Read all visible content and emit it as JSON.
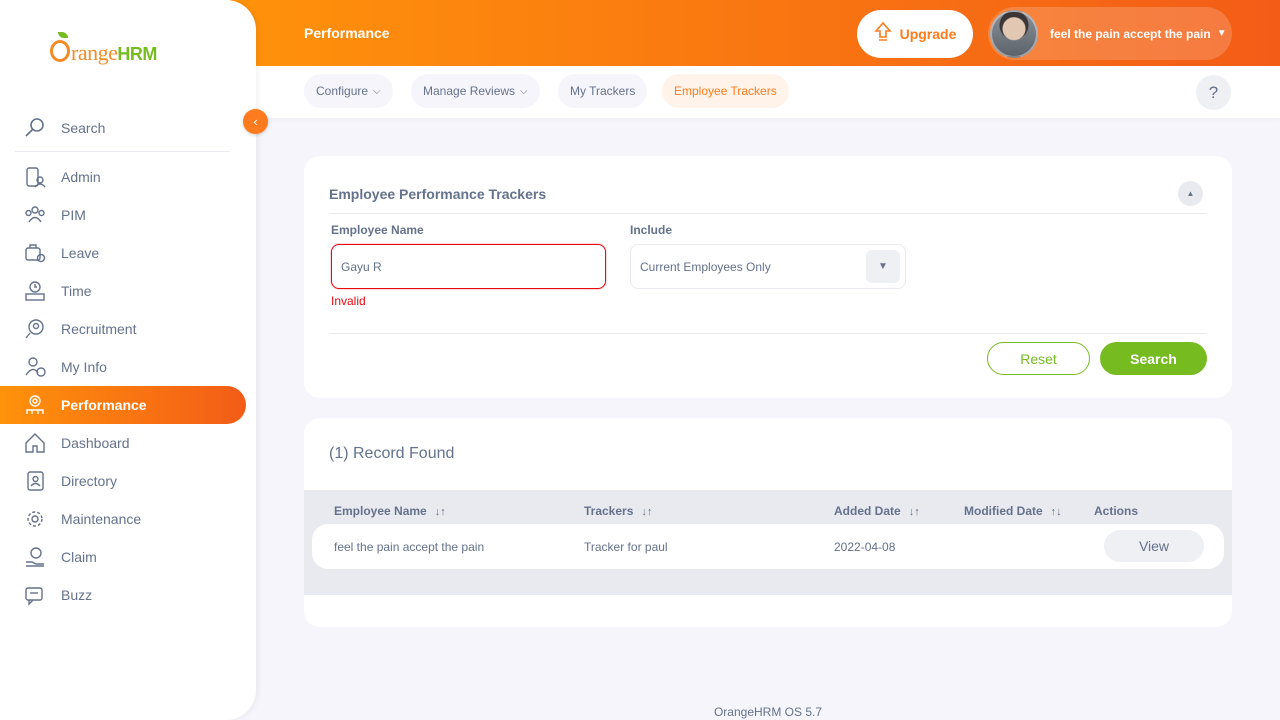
{
  "brand": {
    "name_prefix": "range",
    "name_suffix": "HRM"
  },
  "sidebar": {
    "search_label": "Search",
    "items": [
      {
        "label": "Admin",
        "icon": "admin-icon"
      },
      {
        "label": "PIM",
        "icon": "pim-icon"
      },
      {
        "label": "Leave",
        "icon": "leave-icon"
      },
      {
        "label": "Time",
        "icon": "time-icon"
      },
      {
        "label": "Recruitment",
        "icon": "recruitment-icon"
      },
      {
        "label": "My Info",
        "icon": "my-info-icon"
      },
      {
        "label": "Performance",
        "icon": "performance-icon",
        "active": true
      },
      {
        "label": "Dashboard",
        "icon": "dashboard-icon"
      },
      {
        "label": "Directory",
        "icon": "directory-icon"
      },
      {
        "label": "Maintenance",
        "icon": "maintenance-icon"
      },
      {
        "label": "Claim",
        "icon": "claim-icon"
      },
      {
        "label": "Buzz",
        "icon": "buzz-icon"
      }
    ]
  },
  "header": {
    "title": "Performance",
    "upgrade_label": "Upgrade",
    "user_name": "feel the pain accept the pain"
  },
  "tabs": [
    {
      "label": "Configure",
      "has_dropdown": true
    },
    {
      "label": "Manage Reviews",
      "has_dropdown": true
    },
    {
      "label": "My Trackers",
      "has_dropdown": false
    },
    {
      "label": "Employee Trackers",
      "has_dropdown": false,
      "active": true
    }
  ],
  "help_label": "?",
  "filter": {
    "title": "Employee Performance Trackers",
    "employee_name_label": "Employee Name",
    "employee_name_value": "Gayu  R",
    "employee_name_error": "Invalid",
    "include_label": "Include",
    "include_value": "Current Employees Only",
    "reset_label": "Reset",
    "search_label": "Search"
  },
  "results": {
    "records_text": "(1) Record Found",
    "columns": [
      "Employee Name",
      "Trackers",
      "Added Date",
      "Modified Date",
      "Actions"
    ],
    "rows": [
      {
        "employee_name": "feel the pain accept the pain",
        "tracker": "Tracker for paul",
        "added_date": "2022-04-08",
        "modified_date": "",
        "action_label": "View"
      }
    ]
  },
  "footer": "OrangeHRM OS 5.7",
  "colors": {
    "brand_orange": "#ff7b1d",
    "brand_green": "#76bc21",
    "error_red": "#eb0910",
    "text": "#64728c"
  }
}
